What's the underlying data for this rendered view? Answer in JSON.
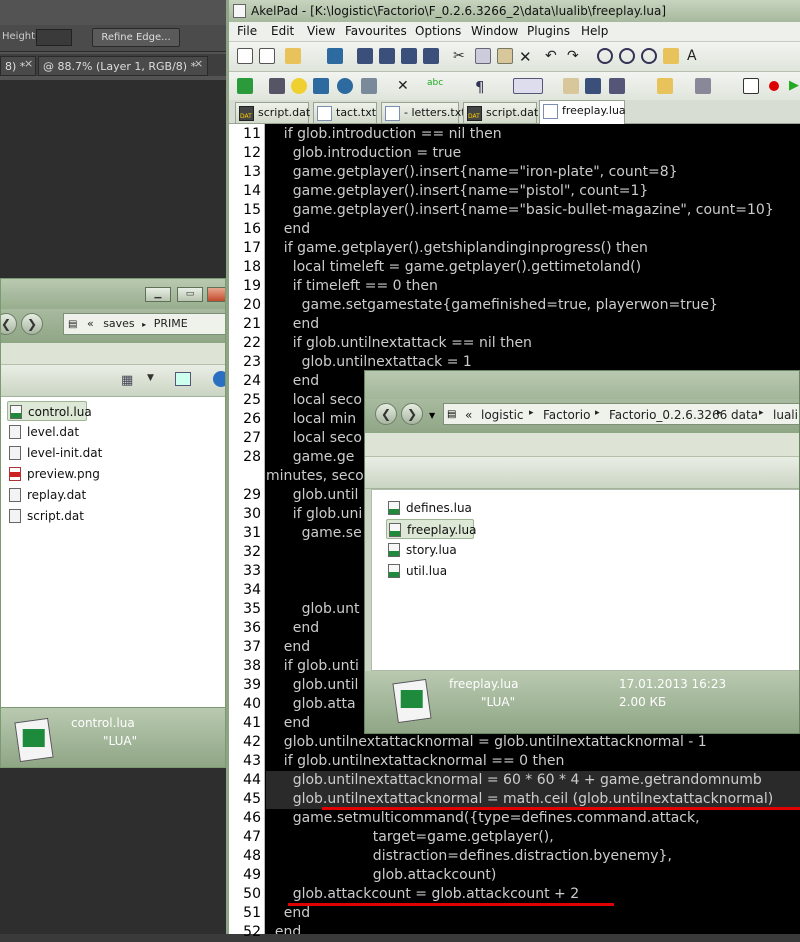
{
  "photoshop": {
    "height_label": "Height:",
    "refine_edge": "Refine Edge...",
    "tab1": "8) *",
    "tab2": "@ 88.7% (Layer 1, RGB/8) *"
  },
  "left_explorer": {
    "breadcrumb": [
      "saves",
      "PRIME"
    ],
    "files": [
      "control.lua",
      "level.dat",
      "level-init.dat",
      "preview.png",
      "replay.dat",
      "script.dat"
    ],
    "selected_name": "control.lua",
    "selected_type": "\"LUA\""
  },
  "akelpad": {
    "title": "AkelPad - [K:\\logistic\\Factorio\\F_0.2.6.3266_2\\data\\lualib\\freeplay.lua]",
    "menu": [
      "File",
      "Edit",
      "View",
      "Favourites",
      "Options",
      "Window",
      "Plugins",
      "Help"
    ],
    "tabs": [
      "script.dat",
      "tact.txt",
      "- letters.txt",
      "script.dat",
      "freeplay.lua"
    ],
    "line_numbers": [
      "11",
      "12",
      "13",
      "14",
      "15",
      "16",
      "17",
      "18",
      "19",
      "20",
      "21",
      "22",
      "23",
      "24",
      "25",
      "26",
      "27",
      "28",
      "",
      "29",
      "30",
      "31",
      "32",
      "33",
      "34",
      "35",
      "36",
      "37",
      "38",
      "39",
      "40",
      "41",
      "42",
      "43",
      "44",
      "45",
      "46",
      "47",
      "48",
      "49",
      "50",
      "51",
      "52"
    ],
    "lines": [
      "    if glob.introduction == nil then",
      "      glob.introduction = true",
      "      game.getplayer().insert{name=\"iron-plate\", count=8}",
      "      game.getplayer().insert{name=\"pistol\", count=1}",
      "      game.getplayer().insert{name=\"basic-bullet-magazine\", count=10}",
      "    end",
      "    if game.getplayer().getshiplandinginprogress() then",
      "      local timeleft = game.getplayer().gettimetoland()",
      "      if timeleft == 0 then",
      "        game.setgamestate{gamefinished=true, playerwon=true}",
      "      end",
      "      if glob.untilnextattack == nil then",
      "        glob.untilnextattack = 1",
      "      end",
      "      local seco",
      "      local min",
      "      local seco",
      "      game.ge",
      "minutes, seco",
      "      glob.until",
      "      if glob.uni",
      "        game.se",
      "",
      "",
      "",
      "        glob.unt",
      "      end",
      "    end",
      "    if glob.unti",
      "      glob.until",
      "      glob.atta",
      "    end",
      "    glob.untilnextattacknormal = glob.untilnextattacknormal - 1",
      "    if glob.untilnextattacknormal == 0 then",
      "      glob.untilnextattacknormal = 60 * 60 * 4 + game.getrandomnumb",
      "      glob.untilnextattacknormal = math.ceil (glob.untilnextattacknormal)",
      "      game.setmulticommand({type=defines.command.attack,",
      "                        target=game.getplayer(),",
      "                        distraction=defines.distraction.byenemy},",
      "                        glob.attackcount)",
      "      glob.attackcount = glob.attackcount + 2",
      "    end",
      "  end"
    ]
  },
  "right_explorer": {
    "breadcrumb": [
      "logistic",
      "Factorio",
      "Factorio_0.2.6.3266",
      "data",
      "lualib"
    ],
    "files": [
      "defines.lua",
      "freeplay.lua",
      "story.lua",
      "util.lua"
    ],
    "selected_name": "freeplay.lua",
    "selected_type": "\"LUA\"",
    "selected_date": "17.01.2013 16:23",
    "selected_size": "2.00 КБ"
  },
  "colors": {
    "underline": "#e00000",
    "code_text": "#cccccc"
  }
}
